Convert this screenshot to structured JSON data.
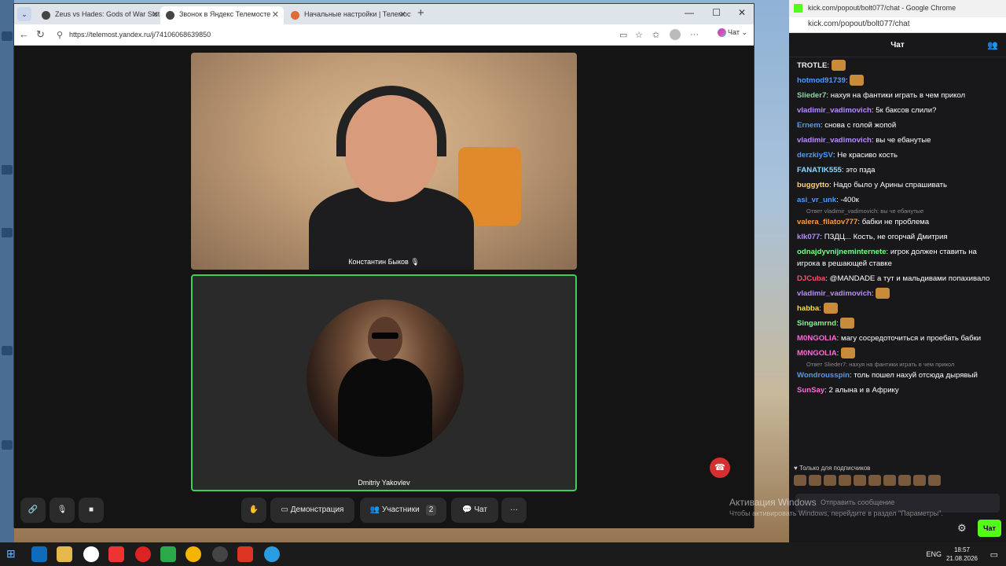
{
  "browser": {
    "tabs": [
      {
        "title": "Zeus vs Hades: Gods of War Slot |"
      },
      {
        "title": "Звонок в Яндекс Телемосте"
      },
      {
        "title": "Начальные настройки | Телемост"
      }
    ],
    "url": "https://telemost.yandex.ru/j/74106068639850",
    "chat_label": "Чат"
  },
  "call": {
    "participant1": "Константин Быков",
    "participant2": "Dmitriy Yakovlev",
    "controls": {
      "demo": "Демонстрация",
      "participants": "Участники",
      "participants_count": "2",
      "chat": "Чат"
    }
  },
  "kick": {
    "window_title": "kick.com/popout/bolt077/chat - Google Chrome",
    "url": "kick.com/popout/bolt077/chat",
    "header": "Чат",
    "messages": [
      {
        "user": "TROTLE",
        "color": "#f2f2f2",
        "text": ""
      },
      {
        "user": "hotmod91739",
        "color": "#4e9bff",
        "text": ""
      },
      {
        "user": "Slieder7",
        "color": "#8bd8a8",
        "text": "нахуя на фантики играть в чем прикол"
      },
      {
        "user": "vladimir_vadimovich",
        "color": "#b68cff",
        "text": "5к баксов слили?"
      },
      {
        "user": "Ernem",
        "color": "#4e9bff",
        "text": "снова с голой жопой"
      },
      {
        "user": "vladimir_vadimovich",
        "color": "#b68cff",
        "text": "вы че ебанутые"
      },
      {
        "user": "derzkiySV",
        "color": "#4e9bff",
        "text": "Не красиво кость"
      },
      {
        "user": "FANATIK555",
        "color": "#8bd8ff",
        "text": "это пзда"
      },
      {
        "user": "buggytto",
        "color": "#ffd75e",
        "text": "Надо было у Арины спрашивать"
      },
      {
        "user": "asi_vr_unk",
        "color": "#4e9bff",
        "text": "-400к"
      },
      {
        "user": "valera_filatov777",
        "color": "#ff9a3c",
        "text": "бабки не проблема"
      },
      {
        "user": "klk077",
        "color": "#b68cff",
        "text": "ПЗДЦ... Кость, не огорчай Дмитрия"
      },
      {
        "user": "odnajdyvnijneminternete",
        "color": "#7cfc8a",
        "text": "игрок должен ставить на игрока в решающей ставке"
      },
      {
        "user": "DJCuba",
        "color": "#ff4e6a",
        "text": "@MANDADE а тут и мальдивами попахивало"
      },
      {
        "user": "vladimir_vadimovich",
        "color": "#b68cff",
        "text": ""
      },
      {
        "user": "habba",
        "color": "#ffd75e",
        "text": ""
      },
      {
        "user": "Singamrnd",
        "color": "#7cfc8a",
        "text": ""
      },
      {
        "user": "M0NGOLIA",
        "color": "#ff6bd8",
        "text": "магу сосредоточиться и проебать бабки"
      },
      {
        "user": "M0NGOLIA",
        "color": "#ff6bd8",
        "text": ""
      },
      {
        "user": "Wondrousspin",
        "color": "#4e9bff",
        "text": "толь пошел нахуй отсюда дырявый"
      },
      {
        "user": "SunSay",
        "color": "#ff6bd8",
        "text": "2 алына и в Африку"
      }
    ],
    "reply1": "Ответ vladimir_vadimovich: вы че ебанутые",
    "reply2": "Ответ Slieder7: нахуя на фантики играть в чем прикол",
    "subs_only": "Только для подписчиков",
    "input_placeholder": "Отправить сообщение",
    "send": "Чат"
  },
  "windows": {
    "activation_title": "Активация Windows",
    "activation_sub": "Чтобы активировать Windows, перейдите в раздел \"Параметры\".",
    "lang": "ENG",
    "time": "18:57",
    "date": "21.08.2026"
  }
}
